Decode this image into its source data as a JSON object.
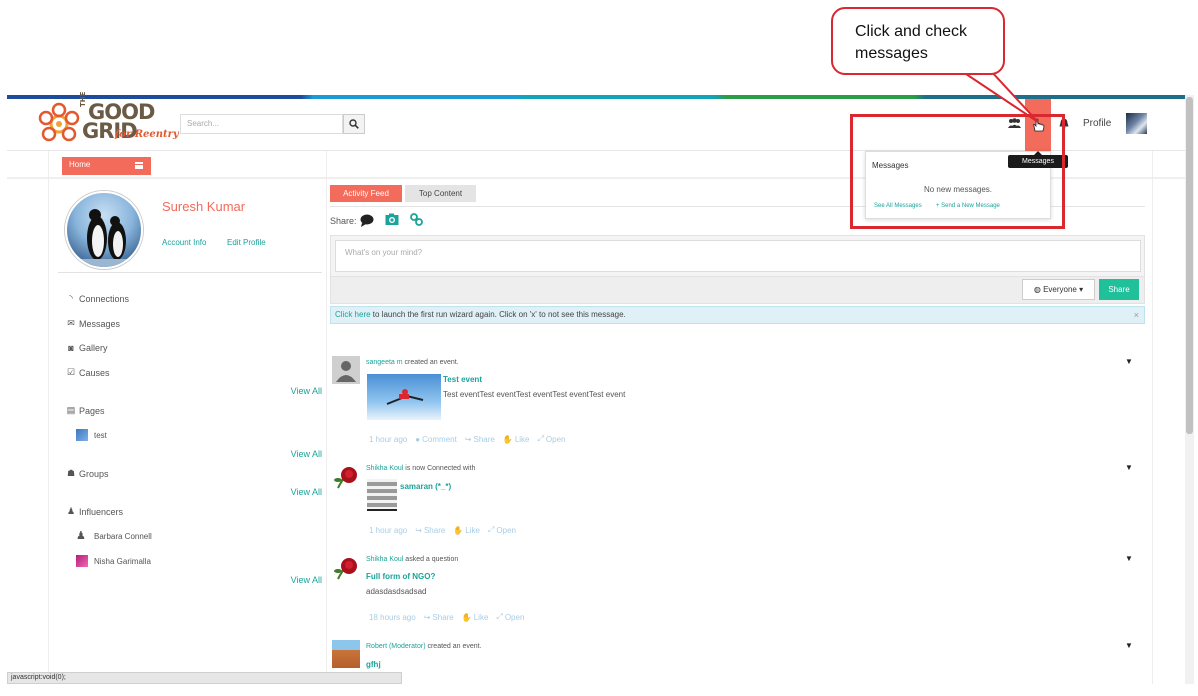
{
  "callout": {
    "text": "Click and check messages"
  },
  "logo": {
    "line1": "THE",
    "line2": "GOOD",
    "line3": "GRID",
    "tagline": "for Reentry"
  },
  "header": {
    "search_placeholder": "Search...",
    "profile_label": "Profile",
    "messages_tooltip": "Messages"
  },
  "messages_dropdown": {
    "title": "Messages",
    "empty_text": "No new messages.",
    "see_all": "See All Messages",
    "send_new": "+ Send a New Message"
  },
  "nav": {
    "home_label": "Home"
  },
  "profile": {
    "name": "Suresh Kumar",
    "account_info": "Account Info",
    "edit_profile": "Edit Profile"
  },
  "sidebar": {
    "connections": "Connections",
    "messages": "Messages",
    "gallery": "Gallery",
    "causes": "Causes",
    "view_all": "View All",
    "pages": "Pages",
    "page_test": "test",
    "groups": "Groups",
    "influencers": "Influencers",
    "influencer_1": "Barbara Connell",
    "influencer_2": "Nisha Garimalla"
  },
  "tabs": {
    "activity_feed": "Activity Feed",
    "top_content": "Top Content"
  },
  "composer": {
    "share_label": "Share:",
    "placeholder": "What's on your mind?",
    "audience": "Everyone",
    "share_button": "Share"
  },
  "alert": {
    "link": "Click here",
    "text": " to launch the first run wizard again. Click on 'x' to not see this message.",
    "close": "×"
  },
  "feed": {
    "item1": {
      "user": "sangeeta m",
      "action": " created an event.",
      "title": "Test event",
      "body": "Test eventTest eventTest eventTest eventTest event",
      "time": "1 hour ago",
      "comment": "Comment",
      "share": "Share",
      "like": "Like",
      "open": "Open"
    },
    "item2": {
      "user": "Shikha Koul",
      "action": " is now Connected with",
      "title": "samaran (*_*)",
      "time": "1 hour ago",
      "share": "Share",
      "like": "Like",
      "open": "Open"
    },
    "item3": {
      "user": "Shikha Koul",
      "action": " asked a question",
      "title": "Full form of NGO?",
      "body": "adasdasdsadsad",
      "time": "18 hours ago",
      "share": "Share",
      "like": "Like",
      "open": "Open"
    },
    "item4": {
      "user": "Robert (Moderator)",
      "action": " created an event.",
      "title": "gfhj"
    }
  },
  "statusbar": {
    "text": "javascript:void(0);"
  },
  "colors": {
    "accent": "#f26b5b",
    "teal": "#1aa39a",
    "share_green": "#20c09a",
    "callout_red": "#d9282f"
  }
}
